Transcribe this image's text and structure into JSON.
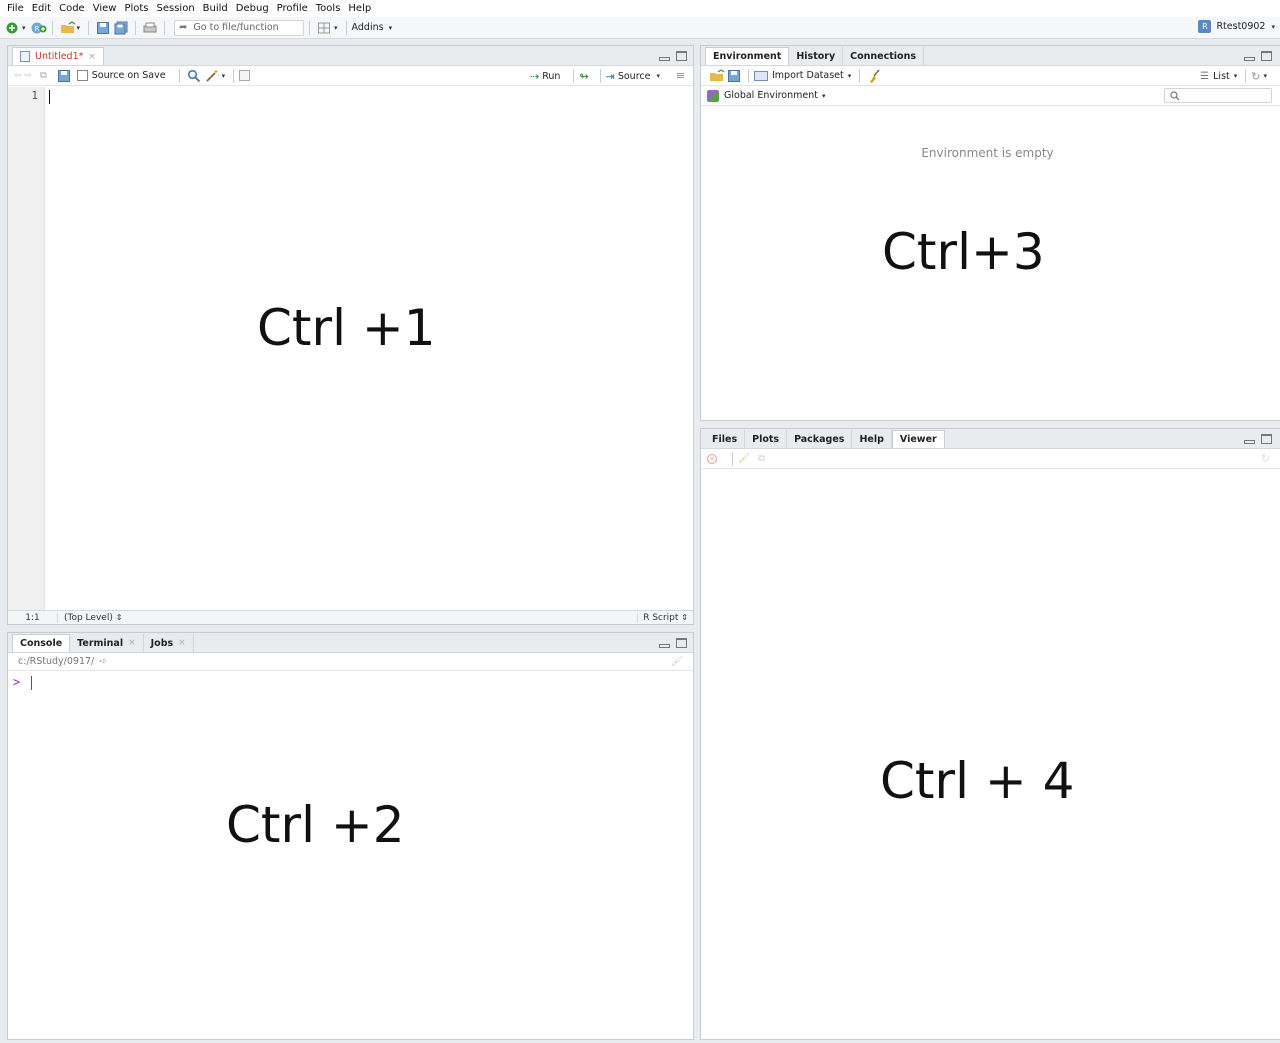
{
  "menu": [
    "File",
    "Edit",
    "Code",
    "View",
    "Plots",
    "Session",
    "Build",
    "Debug",
    "Profile",
    "Tools",
    "Help"
  ],
  "toolbar": {
    "goto_placeholder": "Go to file/function",
    "addins_label": "Addins",
    "project_label": "Rtest0902"
  },
  "editor": {
    "tab_label": "Untitled1*",
    "source_on_save_label": "Source on Save",
    "run_label": "Run",
    "source_label": "Source",
    "line_number": "1",
    "status_position": "1:1",
    "status_level": "(Top Level)",
    "status_filetype": "R Script",
    "overlay_text": "Ctrl +1"
  },
  "console": {
    "tabs": [
      "Console",
      "Terminal",
      "Jobs"
    ],
    "path": "c:/RStudy/0917/",
    "prompt": ">",
    "overlay_text": "Ctrl +2"
  },
  "environment": {
    "tabs": [
      "Environment",
      "History",
      "Connections"
    ],
    "import_label": "Import Dataset",
    "list_label": "List",
    "scope_label": "Global Environment",
    "empty_text": "Environment is empty",
    "overlay_text": "Ctrl+3"
  },
  "files": {
    "tabs": [
      "Files",
      "Plots",
      "Packages",
      "Help",
      "Viewer"
    ],
    "overlay_text": "Ctrl + 4"
  },
  "colors": {
    "accent": "#2e7d32",
    "prompt": "#9a20c2",
    "tab_red": "#c0392b"
  }
}
